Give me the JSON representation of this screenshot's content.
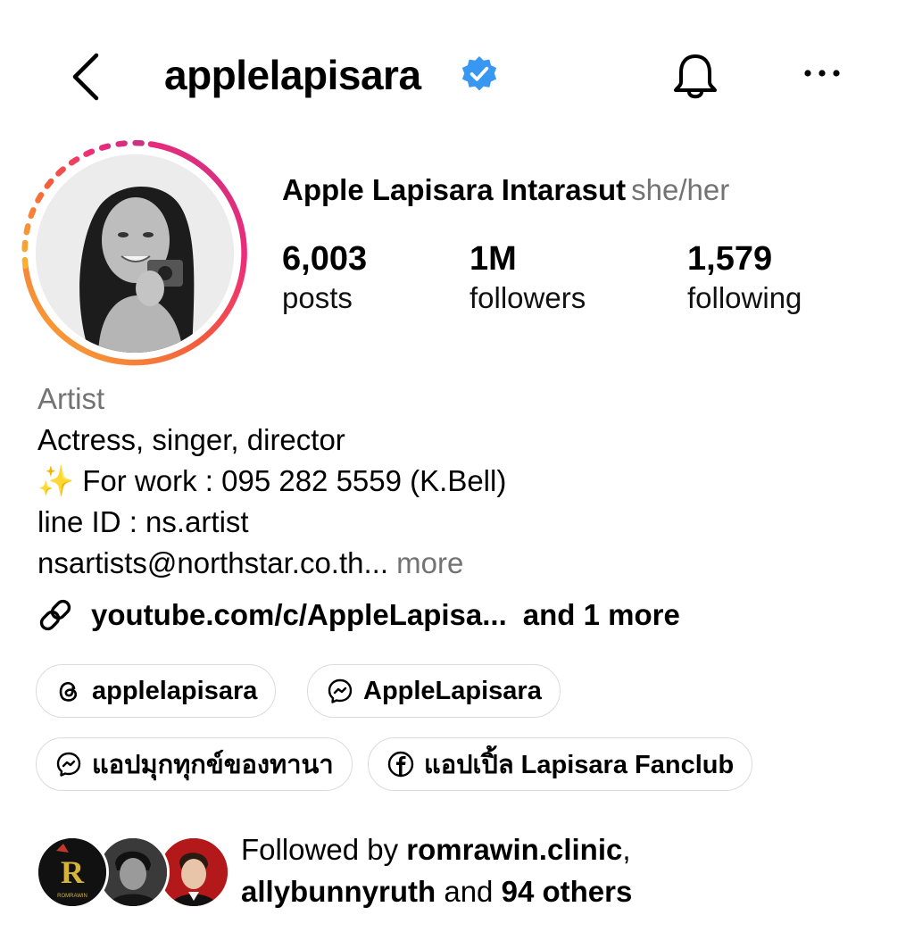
{
  "header": {
    "username": "applelapisara",
    "icons": [
      "back-icon",
      "verified-badge-icon",
      "bell-icon",
      "more-icon"
    ]
  },
  "profile": {
    "full_name": "Apple Lapisara Intarasut",
    "pronouns": "she/her",
    "stats": [
      {
        "value": "6,003",
        "label": "posts"
      },
      {
        "value": "1M",
        "label": "followers"
      },
      {
        "value": "1,579",
        "label": "following"
      }
    ]
  },
  "bio": {
    "category": "Artist",
    "line1": "Actress, singer, director",
    "sparkles": "✨",
    "line2": " For work : 095 282 5559 (K.Bell)",
    "line3": "line ID : ns.artist",
    "line4": "nsartists@northstar.co.th...",
    "more": "more"
  },
  "link": {
    "url": "youtube.com/c/AppleLapisa...",
    "extra": "and 1 more"
  },
  "chips": [
    {
      "icon": "threads-icon",
      "label": "applelapisara"
    },
    {
      "icon": "messenger-icon",
      "label": "AppleLapisara"
    },
    {
      "icon": "messenger-icon",
      "label": "แอปมุกทุกข์ของทานา"
    },
    {
      "icon": "facebook-icon",
      "label": "แอปเปิ้ล Lapisara Fanclub"
    }
  ],
  "followed_by": {
    "prefix": "Followed by ",
    "user1": "romrawin.clinic",
    "sep": ",",
    "user2": "allybunnyruth",
    "mid": " and ",
    "others": "94 others",
    "avatar1_text": "R",
    "avatar1_sub": "ROMRAWIN"
  },
  "colors": {
    "verified_blue": "#3897f0",
    "secondary_text": "#737373",
    "chip_border": "#dbdbdb",
    "ring_gradient": [
      "#f9b233",
      "#ee2a7b",
      "#c13584"
    ]
  }
}
